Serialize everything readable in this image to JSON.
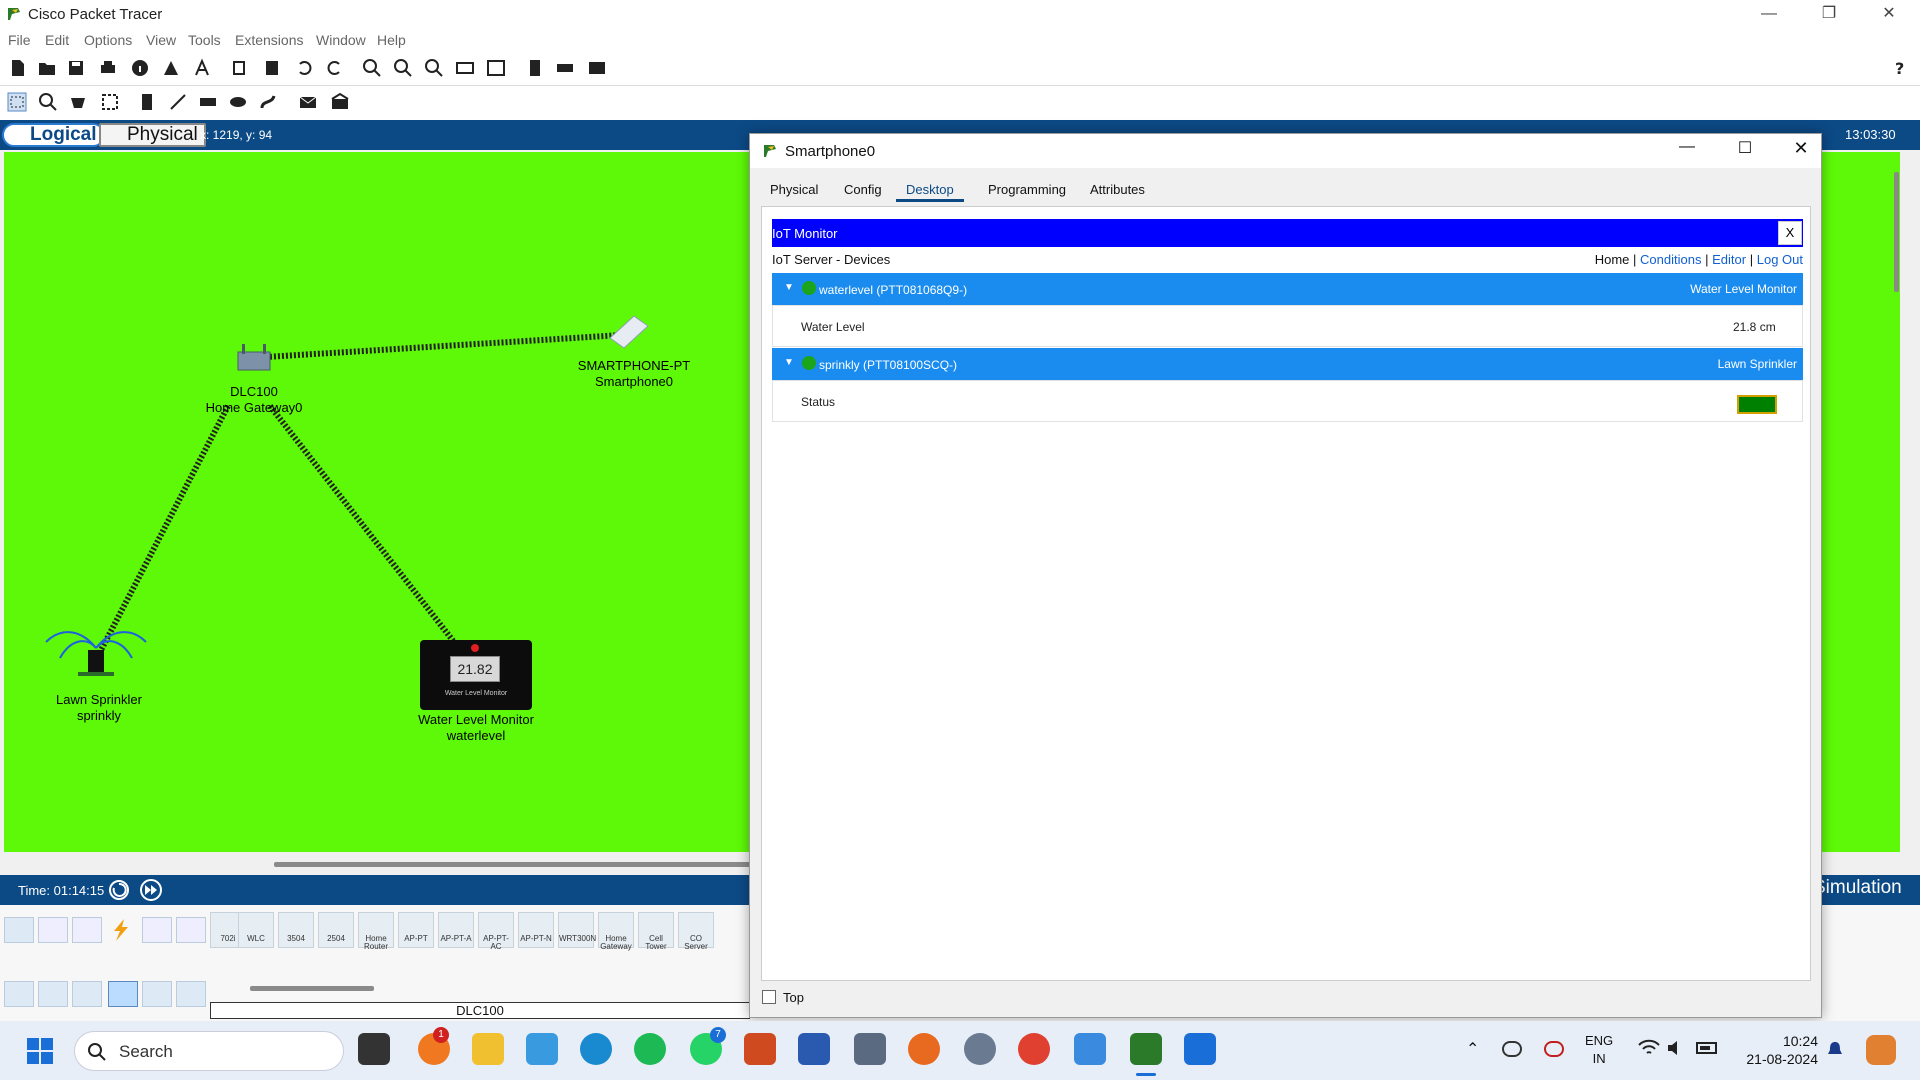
{
  "app": {
    "title": "Cisco Packet Tracer"
  },
  "menu": [
    "File",
    "Edit",
    "Options",
    "View",
    "Tools",
    "Extensions",
    "Window",
    "Help"
  ],
  "workspace": {
    "logical": "Logical",
    "physical": "Physical",
    "coords": "x: 1219, y: 94",
    "clock": "13:03:30"
  },
  "canvas": {
    "gateway_model": "DLC100",
    "gateway_name": "Home Gateway0",
    "phone_model": "SMARTPHONE-PT",
    "phone_name": "Smartphone0",
    "sprinkler_type": "Lawn Sprinkler",
    "sprinkler_name": "sprinkly",
    "monitor_type": "Water Level Monitor",
    "monitor_name": "waterlevel",
    "monitor_display": "21.82",
    "monitor_caption": "Water Level Monitor"
  },
  "timebar": {
    "time": "Time: 01:14:15",
    "simulation": "Simulation"
  },
  "device_palette": [
    "702i",
    "WLC",
    "3504",
    "2504",
    "Home Router",
    "AP-PT",
    "AP-PT-A",
    "AP-PT-AC",
    "AP-PT-N",
    "WRT300N",
    "Home Gateway",
    "Cell Tower",
    "CO Server"
  ],
  "selected_device": "DLC100",
  "phone_window": {
    "title": "Smartphone0",
    "tabs": [
      "Physical",
      "Config",
      "Desktop",
      "Programming",
      "Attributes"
    ],
    "active_tab": "Desktop",
    "iot": {
      "header": "IoT Monitor",
      "close": "X",
      "subtitle": "IoT Server - Devices",
      "links": {
        "home": "Home",
        "conditions": "Conditions",
        "editor": "Editor",
        "logout": "Log Out",
        "sep": "|"
      },
      "devices": [
        {
          "name": "waterlevel (PTT081068Q9-)",
          "type": "Water Level Monitor",
          "field": "Water Level",
          "value": "21.8 cm"
        },
        {
          "name": "sprinkly (PTT08100SCQ-)",
          "type": "Lawn Sprinkler",
          "field": "Status",
          "value": ""
        }
      ],
      "status_color": "#008000"
    },
    "top_checkbox": "Top"
  },
  "taskbar": {
    "search": "Search",
    "lang": "ENG",
    "region": "IN",
    "time": "10:24",
    "date": "21-08-2024",
    "badge_whatsapp": "7",
    "badge_office": "1"
  }
}
